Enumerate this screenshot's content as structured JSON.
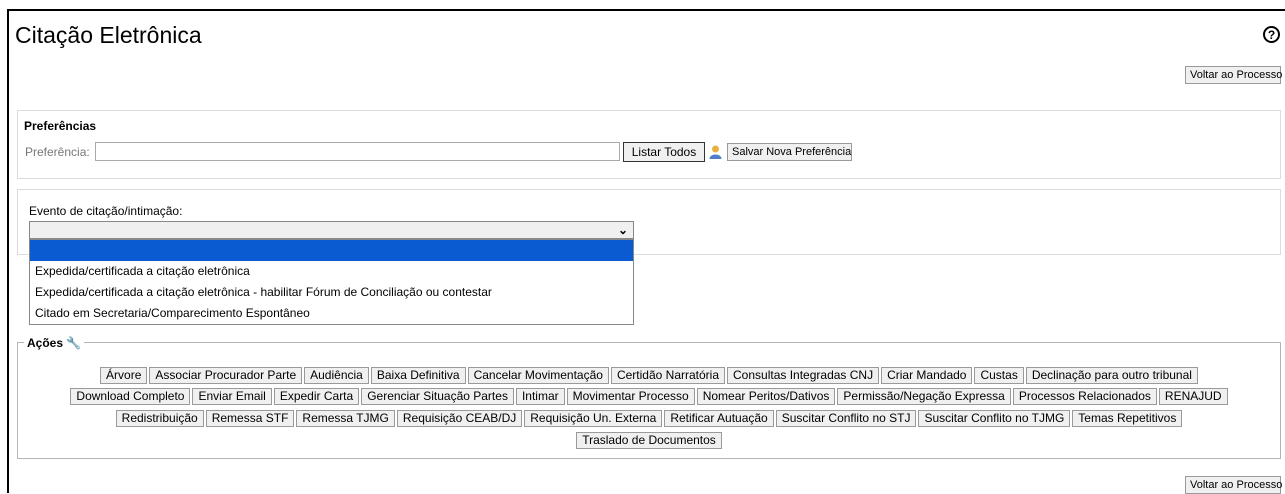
{
  "page": {
    "title": "Citação Eletrônica"
  },
  "header": {
    "help_symbol": "?"
  },
  "voltar_label": "Voltar ao Processo",
  "preferencias": {
    "title": "Preferências",
    "label": "Preferência:",
    "input_value": "",
    "listar_label": "Listar Todos",
    "salvar_label": "Salvar Nova Preferência"
  },
  "evento": {
    "label": "Evento de citação/intimação:",
    "selected": "",
    "options": [
      "",
      "Expedida/certificada a citação eletrônica",
      "Expedida/certificada a citação eletrônica - habilitar Fórum de Conciliação ou contestar",
      "Citado em Secretaria/Comparecimento Espontâneo"
    ]
  },
  "acoes": {
    "title": "Ações",
    "rows": [
      [
        "Árvore",
        "Associar Procurador Parte",
        "Audiência",
        "Baixa Definitiva",
        "Cancelar Movimentação",
        "Certidão Narratória",
        "Consultas Integradas CNJ",
        "Criar Mandado",
        "Custas",
        "Declinação para outro tribunal"
      ],
      [
        "Download Completo",
        "Enviar Email",
        "Expedir Carta",
        "Gerenciar Situação Partes",
        "Intimar",
        "Movimentar Processo",
        "Nomear Peritos/Dativos",
        "Permissão/Negação Expressa",
        "Processos Relacionados",
        "RENAJUD"
      ],
      [
        "Redistribuição",
        "Remessa STF",
        "Remessa TJMG",
        "Requisição CEAB/DJ",
        "Requisição Un. Externa",
        "Retificar Autuação",
        "Suscitar Conflito no STJ",
        "Suscitar Conflito no TJMG",
        "Temas Repetitivos"
      ],
      [
        "Traslado de Documentos"
      ]
    ]
  },
  "colors": {
    "accent": "#0a5ad2",
    "button_bg": "#f0f0f0"
  }
}
